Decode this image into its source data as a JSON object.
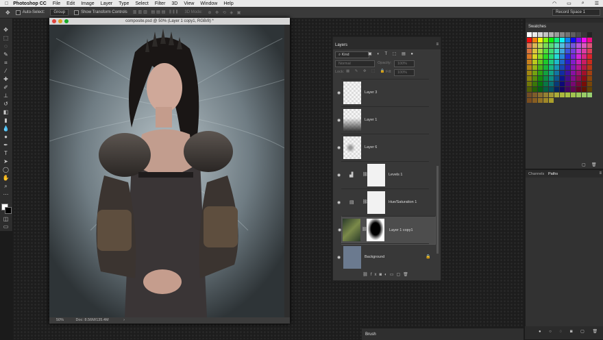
{
  "menubar": {
    "app": "Photoshop CC",
    "items": [
      "File",
      "Edit",
      "Image",
      "Layer",
      "Type",
      "Select",
      "Filter",
      "3D",
      "View",
      "Window",
      "Help"
    ]
  },
  "options": {
    "auto_select": "Auto-Select:",
    "group": "Group",
    "transform": "Show Transform Controls",
    "mode_3d": "3D Mode:",
    "workspace": "Record Space 1"
  },
  "document": {
    "title": "composite.psd @ 50% (Layer 1 copy1, RGB/8) *",
    "zoom": "50%",
    "doc_size": "Doc: 8.56M/135.4M"
  },
  "layers": {
    "tab": "Layers",
    "kind": "Kind",
    "blend": "Normal",
    "opacity_label": "Opacity:",
    "opacity": "100%",
    "lock_label": "Lock:",
    "fill_label": "Fill:",
    "fill": "100%",
    "rows": [
      {
        "name": "Layer 3"
      },
      {
        "name": "Layer 1"
      },
      {
        "name": "Layer 6"
      },
      {
        "name": "Levels 1"
      },
      {
        "name": "Hue/Saturation 1"
      },
      {
        "name": "Layer 1 copy1"
      },
      {
        "name": "Background"
      }
    ]
  },
  "swatches": {
    "tab": "Swatches"
  },
  "channels": {
    "tab1": "Channels",
    "tab2": "Paths"
  },
  "brush": {
    "tab": "Brush"
  },
  "colors": {
    "accent": "#4b7cbf",
    "swatch_bg": "#6b7a8f"
  }
}
